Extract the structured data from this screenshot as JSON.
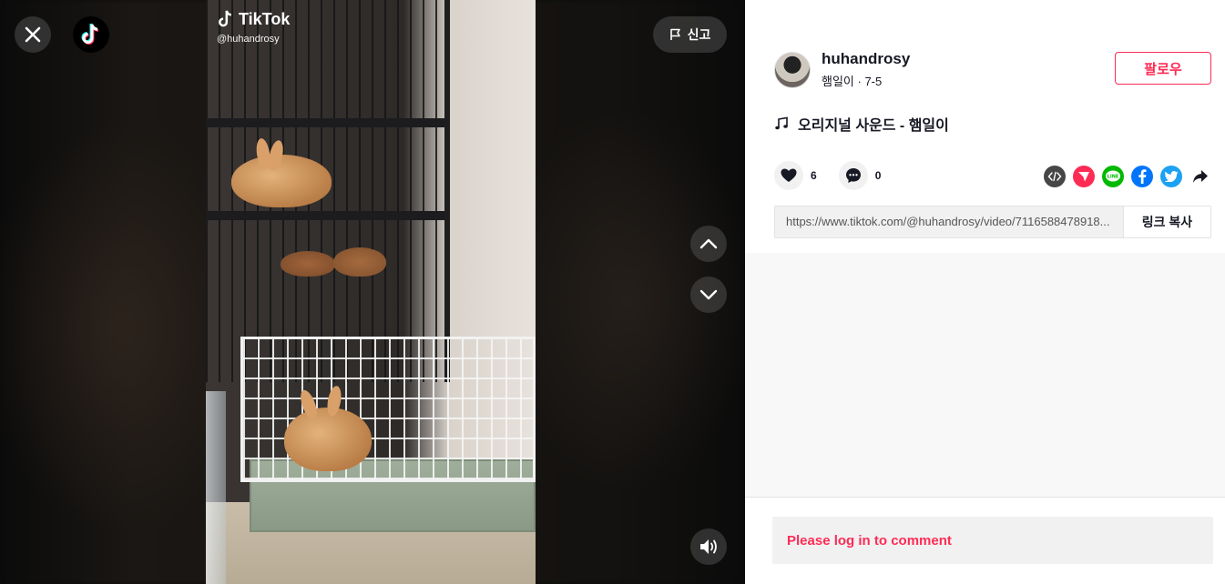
{
  "video": {
    "brand_name": "TikTok",
    "watermark_user": "@huhandrosy",
    "report_label": "신고"
  },
  "author": {
    "username": "huhandrosy",
    "nickname": "햄일이",
    "date": "7-5",
    "meta_separator": " · ",
    "follow_label": "팔로우"
  },
  "music": {
    "title": "오리지널 사운드 - 햄일이"
  },
  "stats": {
    "likes": "6",
    "comments": "0"
  },
  "share": {
    "icons": [
      "embed-icon",
      "send-icon",
      "line-icon",
      "facebook-icon",
      "twitter-icon",
      "share-arrow-icon"
    ],
    "colors": {
      "embed": "#464646",
      "send": "#fe2c55",
      "line": "#00b900",
      "facebook": "#0075fa",
      "twitter": "#1da1f2"
    }
  },
  "link": {
    "url": "https://www.tiktok.com/@huhandrosy/video/7116588478918...",
    "copy_label": "링크 복사"
  },
  "comments": {
    "login_prompt": "Please log in to comment"
  },
  "colors": {
    "accent": "#fe2c55",
    "text_primary": "#161823"
  }
}
